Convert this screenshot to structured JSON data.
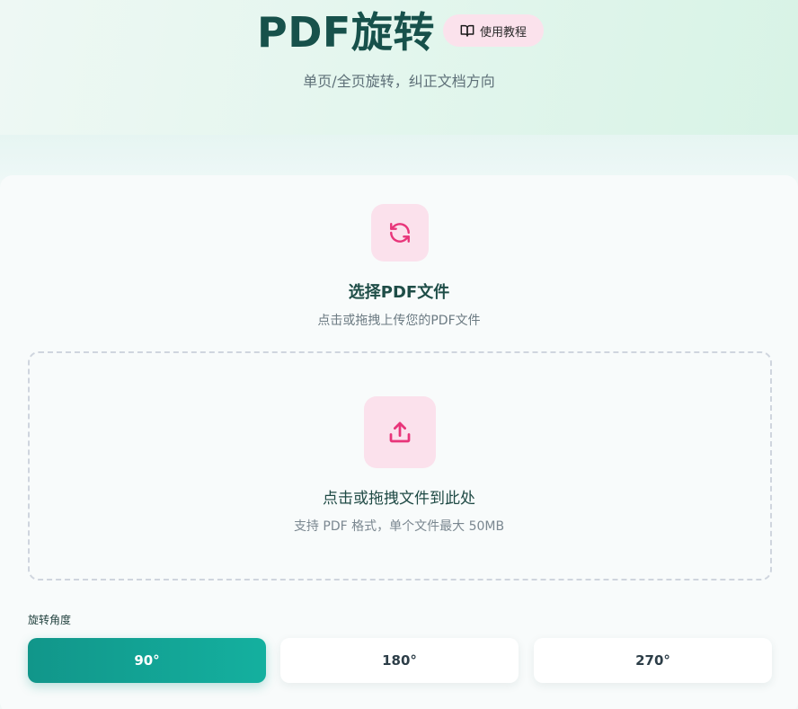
{
  "header": {
    "title": "PDF旋转",
    "tutorial_label": "使用教程",
    "tutorial_icon": "book-open-icon",
    "subtitle": "单页/全页旋转，纠正文档方向"
  },
  "upload": {
    "icon": "rotate-icon",
    "title": "选择PDF文件",
    "subtitle": "点击或拖拽上传您的PDF文件",
    "dropzone": {
      "icon": "upload-icon",
      "title": "点击或拖拽文件到此处",
      "hint": "支持 PDF 格式，单个文件最大 50MB"
    }
  },
  "rotation": {
    "label": "旋转角度",
    "options": [
      {
        "label": "90°",
        "selected": true
      },
      {
        "label": "180°",
        "selected": false
      },
      {
        "label": "270°",
        "selected": false
      }
    ]
  },
  "colors": {
    "accent": "#11968a",
    "title": "#17514b",
    "icon_pink": "#e8357a",
    "tile_pink": "#fbe1ec"
  }
}
